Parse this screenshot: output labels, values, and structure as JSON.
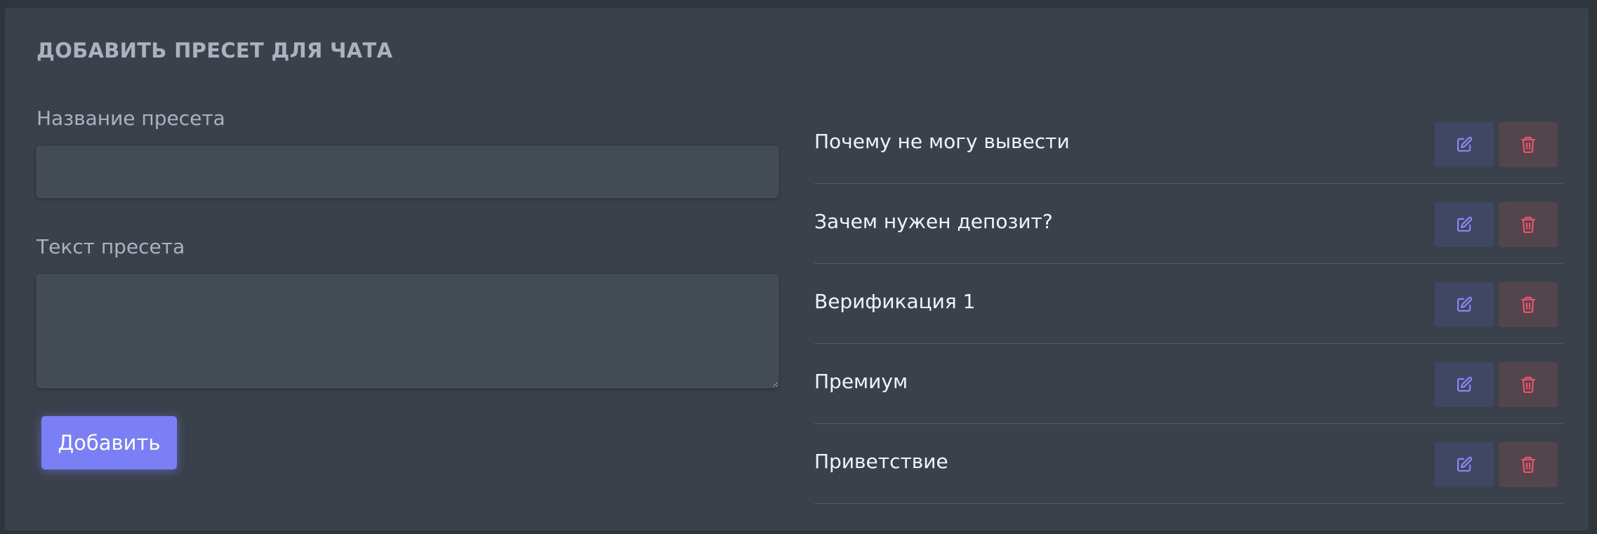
{
  "card": {
    "title": "ДОБАВИТЬ ПРЕСЕТ ДЛЯ ЧАТА"
  },
  "form": {
    "name_label": "Название пресета",
    "name_value": "",
    "text_label": "Текст пресета",
    "text_value": "",
    "submit_label": "Добавить"
  },
  "presets": [
    {
      "name": "Почему не могу вывести"
    },
    {
      "name": "Зачем нужен депозит?"
    },
    {
      "name": "Верификация 1"
    },
    {
      "name": "Премиум"
    },
    {
      "name": "Приветствие"
    }
  ],
  "icons": {
    "edit": "edit-icon",
    "delete": "trash-icon"
  },
  "colors": {
    "accent": "#7b7ff5",
    "edit_icon": "#8a86f5",
    "delete_icon": "#e9546b"
  }
}
